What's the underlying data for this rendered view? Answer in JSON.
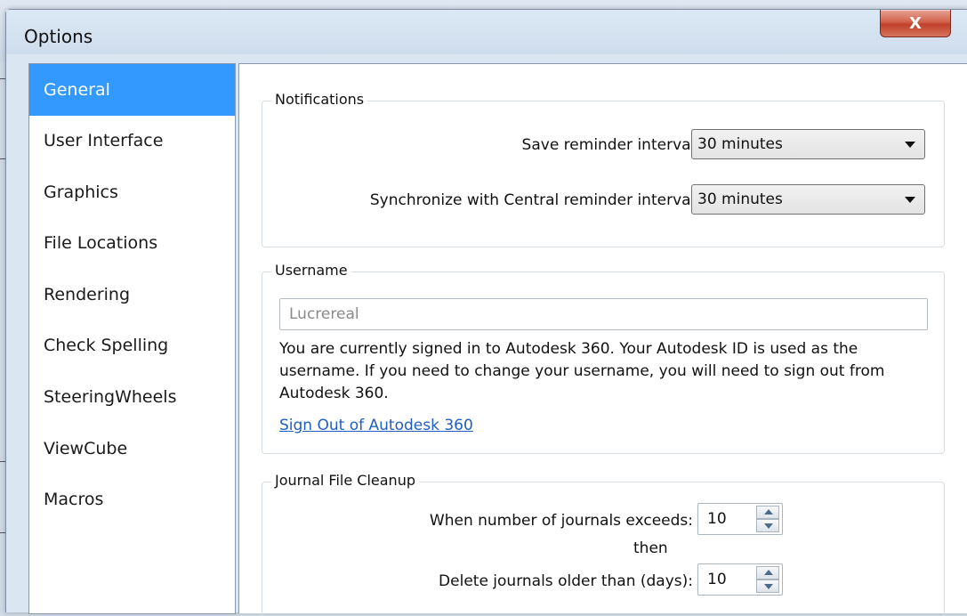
{
  "window": {
    "title": "Options",
    "close_label": "X"
  },
  "sidebar": {
    "items": [
      {
        "label": "General",
        "selected": true
      },
      {
        "label": "User Interface"
      },
      {
        "label": "Graphics"
      },
      {
        "label": "File Locations"
      },
      {
        "label": "Rendering"
      },
      {
        "label": "Check Spelling"
      },
      {
        "label": "SteeringWheels"
      },
      {
        "label": "ViewCube"
      },
      {
        "label": "Macros"
      }
    ]
  },
  "notifications": {
    "group_label": "Notifications",
    "save_reminder_label": "Save reminder interval:",
    "save_reminder_value": "30 minutes",
    "sync_reminder_label": "Synchronize with Central reminder interval:",
    "sync_reminder_value": "30 minutes"
  },
  "username": {
    "group_label": "Username",
    "value": "Lucrereal",
    "description": "You are currently signed in to Autodesk 360. Your Autodesk ID is used as the username. If you need to change your username, you will need to sign out from Autodesk 360.",
    "sign_out_link": "Sign Out of Autodesk 360"
  },
  "journal": {
    "group_label": "Journal File Cleanup",
    "exceeds_label": "When number of journals exceeds:",
    "exceeds_value": "10",
    "then_label": "then",
    "delete_label": "Delete journals older than (days):",
    "delete_value": "10"
  },
  "colors": {
    "selected_bg": "#3399ff",
    "link": "#1f5fc2",
    "close_button": "#c0402a"
  }
}
